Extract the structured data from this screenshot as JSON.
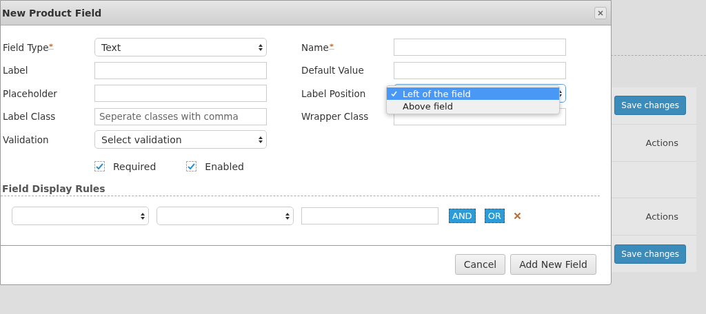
{
  "dialog": {
    "title": "New Product Field",
    "left_fields": [
      {
        "kind": "select",
        "label": "Field Type",
        "required": true,
        "value": "Text"
      },
      {
        "kind": "input",
        "label": "Label",
        "required": false
      },
      {
        "kind": "input",
        "label": "Placeholder",
        "required": false
      },
      {
        "kind": "input",
        "label": "Label Class",
        "required": false,
        "placeholder": "Seperate classes with comma"
      },
      {
        "kind": "select",
        "label": "Validation",
        "required": false,
        "value": "Select validation"
      }
    ],
    "right_fields": [
      {
        "kind": "input",
        "label": "Name",
        "required": true
      },
      {
        "kind": "input",
        "label": "Default Value",
        "required": false
      },
      {
        "kind": "select",
        "label": "Label Position",
        "required": false,
        "open": true,
        "options": [
          {
            "label": "Left of the field",
            "selected": true
          },
          {
            "label": "Above field",
            "selected": false
          }
        ]
      },
      {
        "kind": "input",
        "label": "Wrapper Class",
        "required": false
      }
    ],
    "checkboxes": [
      {
        "label": "Required",
        "checked": true
      },
      {
        "label": "Enabled",
        "checked": true
      }
    ],
    "rules_title": "Field Display Rules",
    "rule": {
      "and": "AND",
      "or": "OR"
    },
    "buttons": [
      "Cancel",
      "Add New Field"
    ]
  },
  "background": {
    "rows": [
      {
        "kind": "button",
        "text": "Save changes"
      },
      {
        "kind": "text",
        "text": "Actions"
      },
      {
        "kind": "empty"
      },
      {
        "kind": "text",
        "text": "Actions"
      },
      {
        "kind": "button",
        "text": "Save changes"
      }
    ]
  }
}
